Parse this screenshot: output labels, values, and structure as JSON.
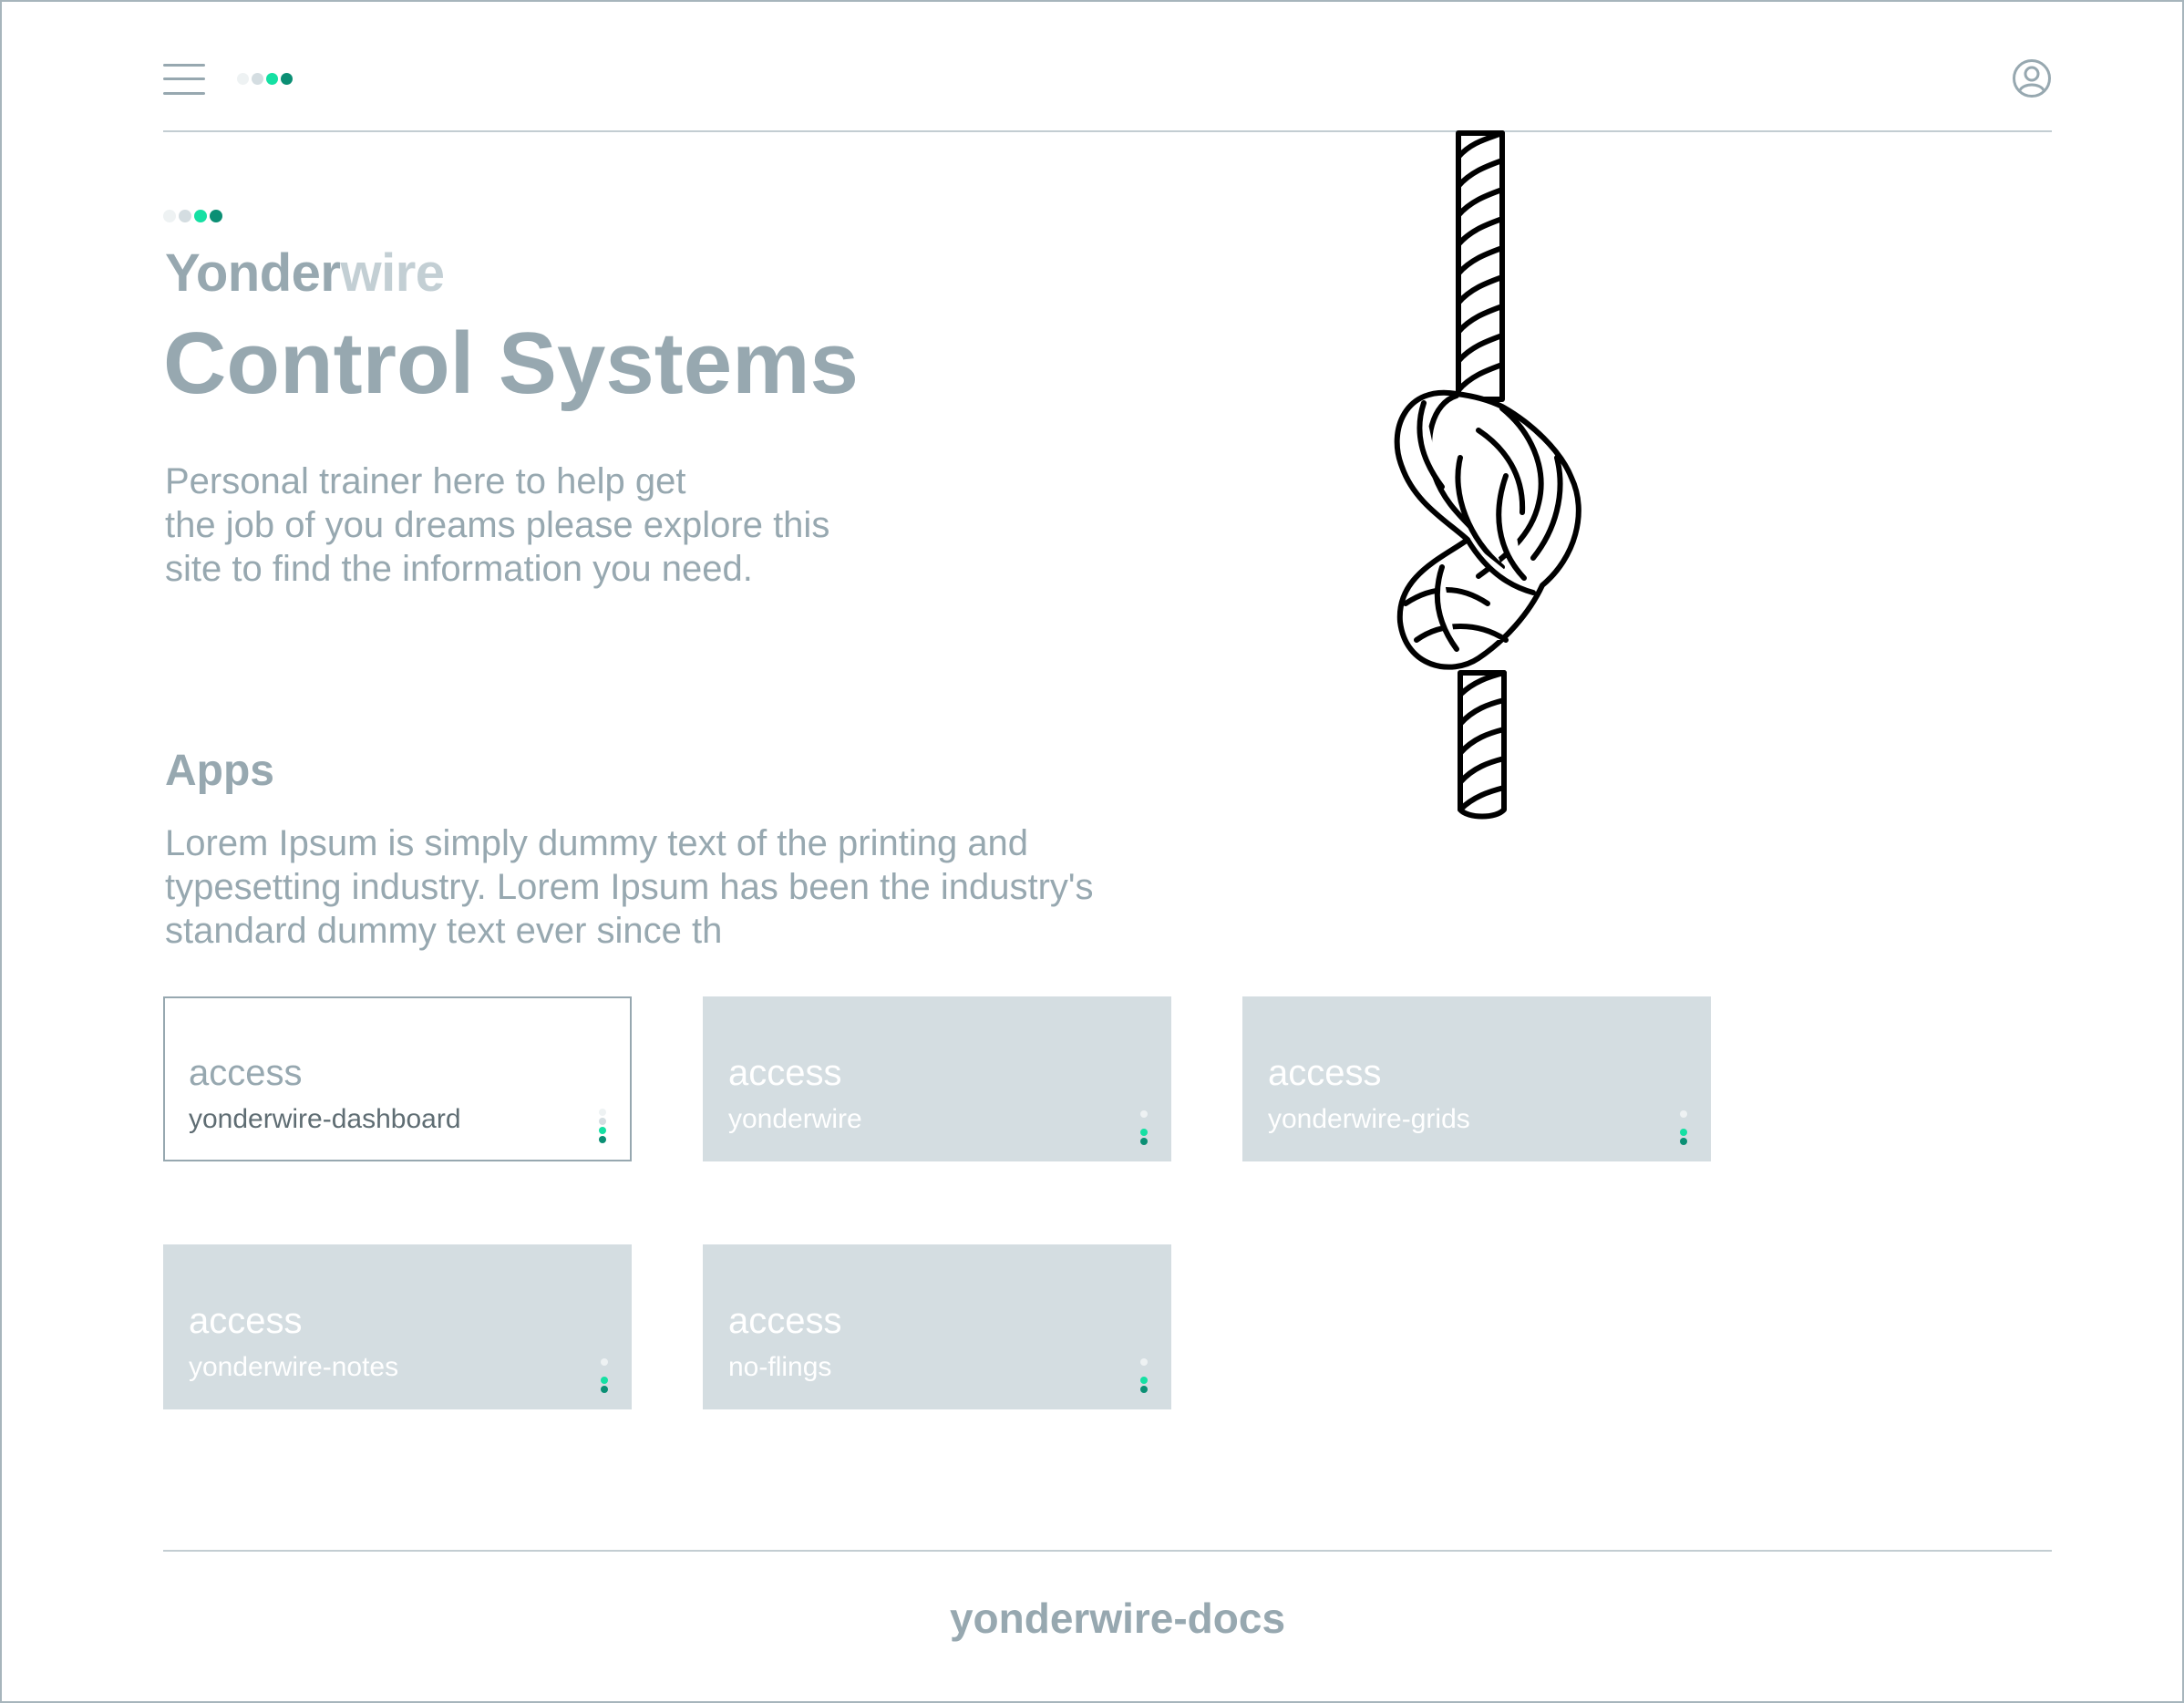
{
  "header": {
    "menu_icon": "menu-icon",
    "logo_dots": [
      "#eef2f3",
      "#d4dde1",
      "#15e0a3",
      "#0b8f74"
    ],
    "profile_icon": "user-circle-icon"
  },
  "hero": {
    "logo_dots": [
      "#eef2f3",
      "#d4dde1",
      "#15e0a3",
      "#0b8f74"
    ],
    "brand_primary": "Yonder",
    "brand_accent": "wire",
    "title": "Control Systems",
    "intro_lines": [
      "Personal trainer here to help get",
      "the job of you dreams please explore this",
      "site to find the information you need."
    ],
    "illustration": "rope-knot-illustration"
  },
  "apps": {
    "title": "Apps",
    "description_lines": [
      "Lorem Ipsum is simply dummy text of the printing and",
      "typesetting industry. Lorem Ipsum has been the industry's",
      "standard dummy text ever since th"
    ],
    "cards": [
      {
        "label": "access",
        "name": "yonderwire-dashboard",
        "active": true
      },
      {
        "label": "access",
        "name": "yonderwire",
        "active": false
      },
      {
        "label": "access",
        "name": "yonderwire-grids",
        "active": false
      },
      {
        "label": "access",
        "name": "yonderwire-notes",
        "active": false
      },
      {
        "label": "access",
        "name": "no-flings",
        "active": false
      }
    ]
  },
  "footer": {
    "link": "yonderwire-docs"
  },
  "colors": {
    "text": "#97a8b0",
    "card_bg": "#d4dde1",
    "accent_green": "#15e0a3",
    "accent_teal": "#0b8f74",
    "frame": "#a7b5bc"
  }
}
